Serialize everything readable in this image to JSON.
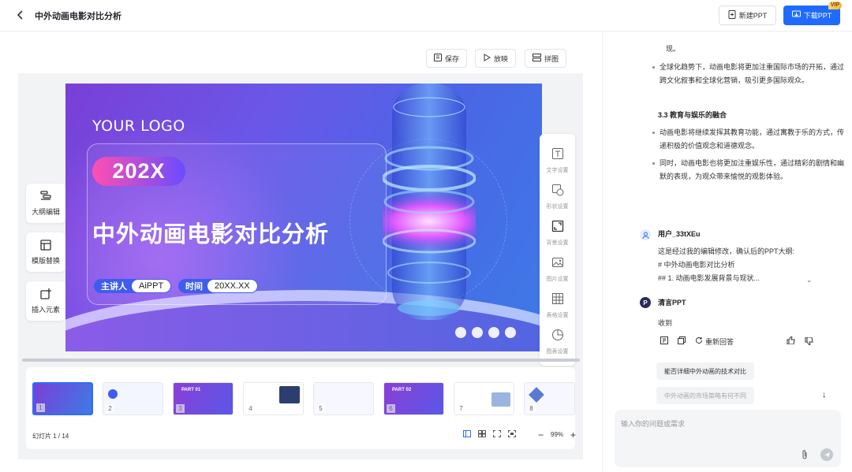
{
  "header": {
    "title": "中外动画电影对比分析",
    "new_ppt": "新建PPT",
    "download_ppt": "下载PPT",
    "vip_badge": "VIP"
  },
  "toolbar": {
    "save": "保存",
    "play": "放映",
    "jigsaw": "拼图"
  },
  "left_tools": [
    {
      "label": "大纲编辑",
      "icon": "outline-icon"
    },
    {
      "label": "模版替换",
      "icon": "template-icon"
    },
    {
      "label": "插入元素",
      "icon": "insert-icon"
    }
  ],
  "slide": {
    "logo": "YOUR LOGO",
    "year": "202X",
    "title": "中外动画电影对比分析",
    "presenter_key": "主讲人",
    "presenter_val": "AiPPT",
    "time_key": "时间",
    "time_val": "20XX.XX"
  },
  "right_tools": [
    {
      "label": "文字设置",
      "icon": "text-icon"
    },
    {
      "label": "形状设置",
      "icon": "shape-icon"
    },
    {
      "label": "背景设置",
      "icon": "background-icon"
    },
    {
      "label": "图片设置",
      "icon": "image-icon"
    },
    {
      "label": "表格设置",
      "icon": "table-icon"
    },
    {
      "label": "图表设置",
      "icon": "chart-icon"
    }
  ],
  "thumbs": {
    "numbers": [
      "1",
      "2",
      "3",
      "4",
      "5",
      "6",
      "7",
      "8"
    ],
    "part01": "PART 01",
    "part02": "PART 02"
  },
  "footer": {
    "slide_count": "幻灯片  1 / 14",
    "zoom": "99%"
  },
  "chat": {
    "line0": "现。",
    "bullet1": "全球化趋势下，动画电影将更加注重国际市场的开拓，通过跨文化叙事和全球化营销，吸引更多国际观众。",
    "section": "3.3 教育与娱乐的融合",
    "bullet2": "动画电影将继续发挥其教育功能，通过寓教于乐的方式，传递积极的价值观念和道德观念。",
    "bullet3": "同时，动画电影也将更加注重娱乐性，通过精彩的剧情和幽默的表现，为观众带来愉悦的观影体验。",
    "user_name": "用户_33tXEu",
    "user_msg1": "这是经过我的编辑修改，确认后的PPT大纲:",
    "user_msg2": "# 中外动画电影对比分析",
    "user_msg3": "## 1. 动画电影发展背景与现状...",
    "bot_name": "清言PPT",
    "bot_msg": "收到",
    "regen": "重新回答",
    "suggestion1": "能否详细中外动画的技术对比",
    "suggestion2": "中外动画的市场策略有何不同",
    "input_placeholder": "输入你的问题或需求"
  }
}
